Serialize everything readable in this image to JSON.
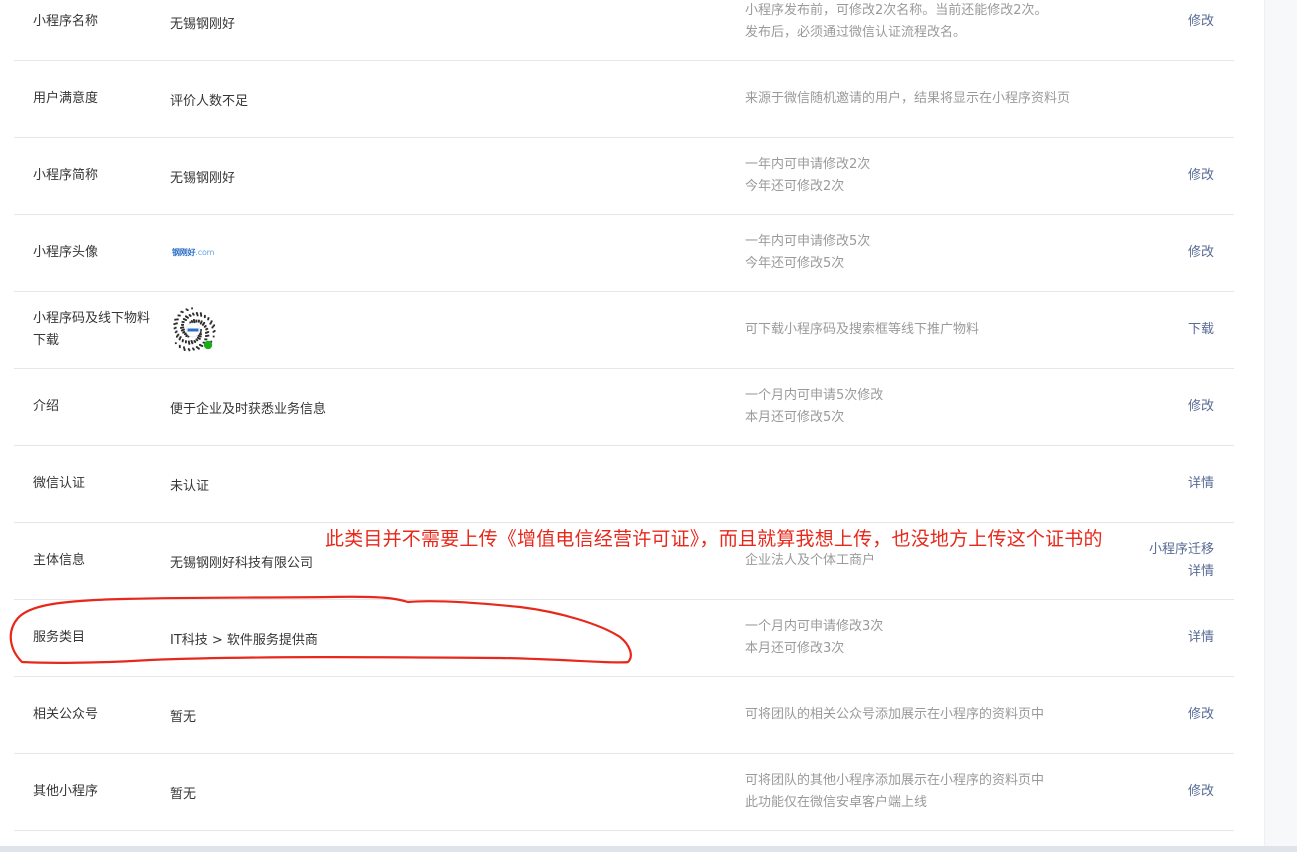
{
  "rows": [
    {
      "label": "小程序名称",
      "value": "无锡钢刚好",
      "desc": [
        "小程序发布前，可修改2次名称。当前还能修改2次。",
        "发布后，必须通过微信认证流程改名。"
      ],
      "actions": [
        "修改"
      ]
    },
    {
      "label": "用户满意度",
      "value": "评价人数不足",
      "desc": [
        "来源于微信随机邀请的用户，结果将显示在小程序资料页"
      ],
      "actions": []
    },
    {
      "label": "小程序简称",
      "value": "无锡钢刚好",
      "desc": [
        "一年内可申请修改2次",
        "今年还可修改2次"
      ],
      "actions": [
        "修改"
      ]
    },
    {
      "label": "小程序头像",
      "value": "",
      "desc": [
        "一年内可申请修改5次",
        "今年还可修改5次"
      ],
      "actions": [
        "修改"
      ]
    },
    {
      "label": "小程序码及线下物料下载",
      "value": "",
      "desc": [
        "可下载小程序码及搜索框等线下推广物料"
      ],
      "actions": [
        "下载"
      ]
    },
    {
      "label": "介绍",
      "value": "便于企业及时获悉业务信息",
      "desc": [
        "一个月内可申请5次修改",
        "本月还可修改5次"
      ],
      "actions": [
        "修改"
      ]
    },
    {
      "label": "微信认证",
      "value": "未认证",
      "desc": [],
      "actions": [
        "详情"
      ]
    },
    {
      "label": "主体信息",
      "value": "无锡钢刚好科技有限公司",
      "desc": [
        "企业法人及个体工商户"
      ],
      "actions": [
        "小程序迁移",
        "详情"
      ]
    },
    {
      "label": "服务类目",
      "value": "IT科技 > 软件服务提供商",
      "desc": [
        "一个月内可申请修改3次",
        "本月还可修改3次"
      ],
      "actions": [
        "详情"
      ]
    },
    {
      "label": "相关公众号",
      "value": "暂无",
      "desc": [
        "可将团队的相关公众号添加展示在小程序的资料页中"
      ],
      "actions": [
        "修改"
      ]
    },
    {
      "label": "其他小程序",
      "value": "暂无",
      "desc": [
        "可将团队的其他小程序添加展示在小程序的资料页中",
        "此功能仅在微信安卓客户端上线"
      ],
      "actions": [
        "修改"
      ]
    }
  ],
  "avatar_logo": {
    "text": "钢刚好",
    "suffix": ".com",
    "icon": "avatar-logo-image"
  },
  "qr_code": {
    "icon": "mini-program-qr-code"
  },
  "annotation": {
    "text": "此类目并不需要上传《增值电信经营许可证》，而且就算我想上传，也没地方上传这个证书的",
    "color": "#e8281b"
  }
}
